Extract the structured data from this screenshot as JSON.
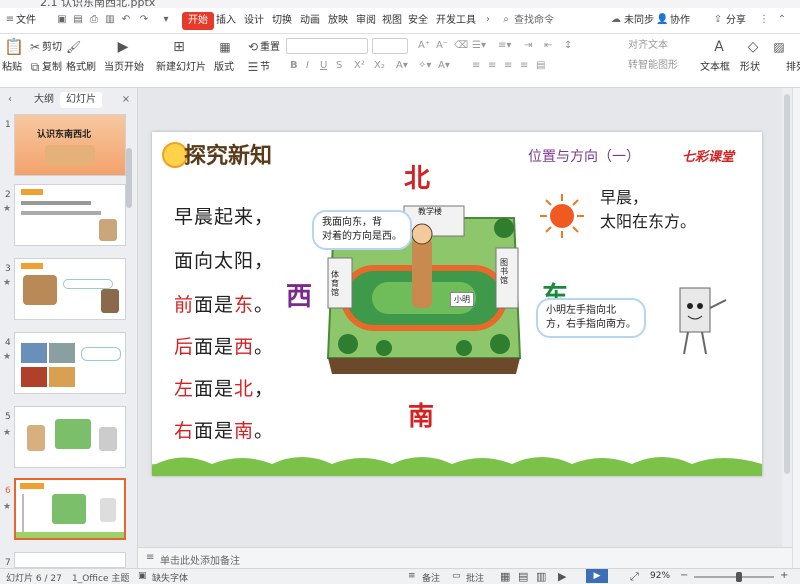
{
  "titlebar": {
    "text": "2.1 认识东南西北.pptx"
  },
  "menu": {
    "file": "文件",
    "start": "开始",
    "insert": "插入",
    "design": "设计",
    "switch": "切换",
    "animation": "动画",
    "slideshow": "放映",
    "review": "审阅",
    "view": "视图",
    "security": "安全",
    "devtools": "开发工具",
    "search": "查找命令",
    "sync": "未同步",
    "collab": "协作",
    "share": "分享"
  },
  "ribbon": {
    "paste": "粘贴",
    "cut": "剪切",
    "copy": "复制",
    "format_painter": "格式刷",
    "from_current": "当页开始",
    "new_slide": "新建幻灯片",
    "layout": "版式",
    "section": "节",
    "reset": "重置",
    "align_text": "对齐文本",
    "to_smartart": "转智能图形",
    "textbox": "文本框",
    "shape": "形状",
    "arrange": "排列"
  },
  "panel": {
    "tab_outline": "大纲",
    "tab_slides": "幻灯片"
  },
  "thumbs": [
    {
      "num": "1",
      "title": "认识东南西北"
    },
    {
      "num": "2"
    },
    {
      "num": "3"
    },
    {
      "num": "4"
    },
    {
      "num": "5"
    },
    {
      "num": "6"
    },
    {
      "num": "7"
    }
  ],
  "slide": {
    "heading": "探究新知",
    "lesson": "位置与方向（一）",
    "brand": "七彩课堂",
    "north": "北",
    "south": "南",
    "west": "西",
    "east": "东",
    "poem": {
      "l1": "早晨起来，",
      "l2": "面向太阳，",
      "l3a": "前",
      "l3b": "面是",
      "l3c": "东",
      "l3d": "。",
      "l4a": "后",
      "l4b": "面是",
      "l4c": "西",
      "l4d": "。",
      "l5a": "左",
      "l5b": "面是",
      "l5c": "北",
      "l5d": "，",
      "l6a": "右",
      "l6b": "面是",
      "l6c": "南",
      "l6d": "。"
    },
    "morning1": "早晨，",
    "morning2": "太阳在东方。",
    "bubble_boy1": "我面向东，背",
    "bubble_boy2": "对着的方向是西。",
    "bubble_book1": "小明左手指向北",
    "bubble_book2": "方，右手指向南方。",
    "building_teach": "教学楼",
    "building_gym": "体育馆",
    "building_library": "图书馆",
    "boy_label": "小明"
  },
  "notes": {
    "placeholder": "单击此处添加备注"
  },
  "status": {
    "slide_info": "幻灯片 6 / 27",
    "theme": "1_Office 主题",
    "font_missing": "缺失字体",
    "notes_btn": "备注",
    "comment_btn": "批注",
    "zoom": "92%"
  },
  "colors": {
    "accent": "#e63a2b",
    "selected_thumb": "#e8652f"
  }
}
